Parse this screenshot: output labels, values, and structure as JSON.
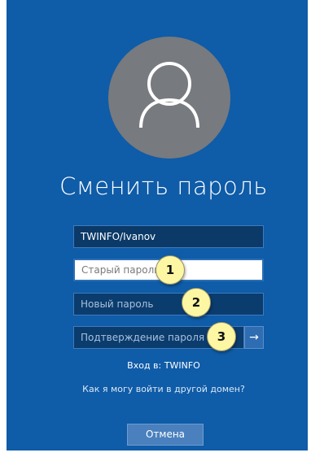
{
  "heading": "Сменить пароль",
  "avatar": {
    "icon": "user-icon"
  },
  "fields": {
    "username_value": "TWINFO/Ivanov",
    "old_password_placeholder": "Старый пароль",
    "new_password_placeholder": "Новый пароль",
    "confirm_password_placeholder": "Подтверждение пароля"
  },
  "submit": {
    "icon": "arrow-right-icon",
    "glyph": "→"
  },
  "callouts": [
    "1",
    "2",
    "3"
  ],
  "signin_to": "Вход в: TWINFO",
  "other_domain_link": "Как я могу войти в другой домен?",
  "cancel_label": "Отмена",
  "colors": {
    "background": "#0f5ca8",
    "field": "#0b3c6e",
    "avatar": "#777a7e",
    "callout": "#fdf6a3"
  }
}
